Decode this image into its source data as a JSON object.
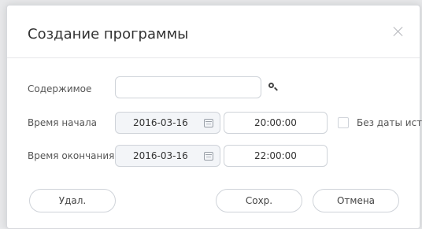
{
  "dialog": {
    "title": "Создание программы"
  },
  "form": {
    "content_label": "Содержимое",
    "content_value": "",
    "start_label": "Время начала",
    "start_date": "2016-03-16",
    "start_time": "20:00:00",
    "end_label": "Время окончания",
    "end_date": "2016-03-16",
    "end_time": "22:00:00",
    "no_expiry_label": "Без даты исте"
  },
  "buttons": {
    "delete": "Удал.",
    "save": "Сохр.",
    "cancel": "Отмена"
  },
  "icons": {
    "close": "close-icon",
    "search": "search-icon",
    "calendar": "calendar-icon"
  }
}
